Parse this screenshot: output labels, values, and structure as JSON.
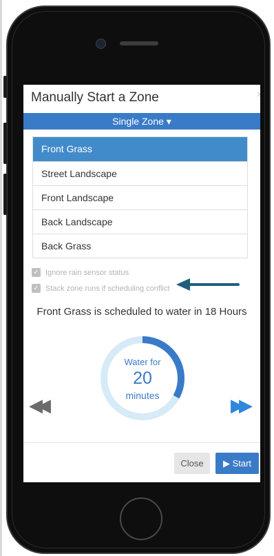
{
  "modal": {
    "title": "Manually Start a Zone",
    "close_symbol": "×"
  },
  "mode_selector": {
    "label": "Single Zone",
    "caret": "▾"
  },
  "zones": [
    {
      "label": "Front Grass",
      "selected": true
    },
    {
      "label": "Street Landscape",
      "selected": false
    },
    {
      "label": "Front Landscape",
      "selected": false
    },
    {
      "label": "Back Landscape",
      "selected": false
    },
    {
      "label": "Back Grass",
      "selected": false
    }
  ],
  "options": {
    "ignore_rain": {
      "label": "Ignore rain sensor status",
      "checked": true
    },
    "stack_runs": {
      "label": "Stack zone runs if scheduling conflict",
      "checked": true
    }
  },
  "schedule_text": "Front Grass is scheduled to water in 18 Hours",
  "duration": {
    "prefix": "Water for",
    "value": "20",
    "unit": "minutes",
    "dial_fill_fraction": 0.33
  },
  "nav": {
    "prev_glyph": "◀◀",
    "next_glyph": "▶▶"
  },
  "footer": {
    "close_label": "Close",
    "start_icon": "▶",
    "start_label": "Start"
  },
  "colors": {
    "accent": "#3a7bc8",
    "selected_row": "#428bca",
    "annotation_arrow": "#1f5f7a",
    "dial_track": "#d6eaf8"
  },
  "icons": [
    "check-icon",
    "arrow-annotation-icon",
    "rewind-icon",
    "fast-forward-icon",
    "play-icon"
  ]
}
